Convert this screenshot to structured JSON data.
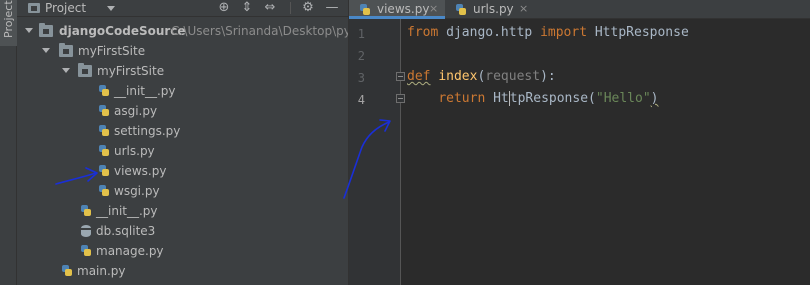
{
  "toolstrip": {
    "project_label": "Project"
  },
  "project_panel": {
    "title": "Project",
    "tree": [
      {
        "label": "djangoCodeSource",
        "path": "C:\\Users\\Srinanda\\Desktop\\pytho",
        "type": "folder"
      },
      {
        "label": "myFirstSite",
        "type": "folder"
      },
      {
        "label": "myFirstSite",
        "type": "folder"
      },
      {
        "label": "__init__.py",
        "type": "python"
      },
      {
        "label": "asgi.py",
        "type": "python"
      },
      {
        "label": "settings.py",
        "type": "python"
      },
      {
        "label": "urls.py",
        "type": "python"
      },
      {
        "label": "views.py",
        "type": "python"
      },
      {
        "label": "wsgi.py",
        "type": "python"
      },
      {
        "label": "__init__.py",
        "type": "python"
      },
      {
        "label": "db.sqlite3",
        "type": "database"
      },
      {
        "label": "manage.py",
        "type": "python"
      },
      {
        "label": "main.py",
        "type": "python"
      }
    ]
  },
  "editor": {
    "tabs": [
      {
        "label": "views.py",
        "close": "×",
        "active": true
      },
      {
        "label": "urls.py",
        "close": "×",
        "active": false
      }
    ],
    "line_numbers": [
      "1",
      "2",
      "3",
      "4"
    ],
    "code": {
      "l1_kw1": "from",
      "l1_mod": " django.http ",
      "l1_kw2": "import",
      "l1_cls": " HttpResponse",
      "l3_kw": "def",
      "l3_fn": "index",
      "l3_open": "(",
      "l3_param": "request",
      "l3_close": "):",
      "l4_indent": "    ",
      "l4_kw": "return",
      "l4_cls_a": " Ht",
      "l4_cls_b": "tpResponse",
      "l4_open": "(",
      "l4_str": "\"Hello\"",
      "l4_close": ")"
    }
  },
  "colors": {
    "accent": "#4a88c7",
    "annotation": "#1a2fd6",
    "keyword": "#cc7832",
    "function": "#ffc66d",
    "string": "#6a8759"
  }
}
